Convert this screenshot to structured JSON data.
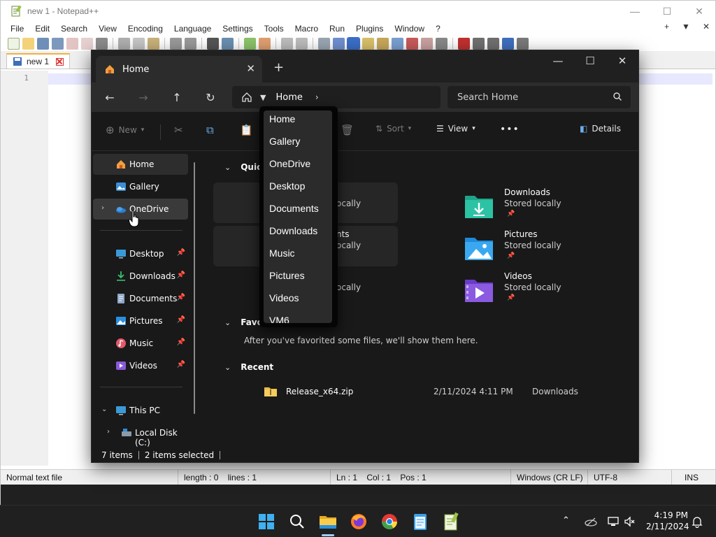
{
  "notepad": {
    "title": "new 1 - Notepad++",
    "menu": [
      "File",
      "Edit",
      "Search",
      "View",
      "Encoding",
      "Language",
      "Settings",
      "Tools",
      "Macro",
      "Run",
      "Plugins",
      "Window",
      "?"
    ],
    "menu_right": [
      "+",
      "▼",
      "✕"
    ],
    "tab_label": "new 1",
    "line_number": "1",
    "status": {
      "type": "Normal text file",
      "length_lines": "length : 0    lines : 1",
      "position": "Ln : 1    Col : 1    Pos : 1",
      "eol": "Windows (CR LF)",
      "encoding": "UTF-8",
      "mode": "INS"
    }
  },
  "explorer": {
    "tab_title": "Home",
    "address": {
      "current": "Home"
    },
    "search_placeholder": "Search Home",
    "commands": {
      "new": "New",
      "sort": "Sort",
      "view": "View",
      "details": "Details",
      "more": "•••"
    },
    "sidebar": {
      "top": [
        {
          "label": "Home",
          "icon": "home-icon"
        },
        {
          "label": "Gallery",
          "icon": "gallery-icon"
        },
        {
          "label": "OneDrive",
          "icon": "onedrive-icon"
        }
      ],
      "pinned": [
        {
          "label": "Desktop",
          "icon": "desktop-icon"
        },
        {
          "label": "Downloads",
          "icon": "downloads-icon"
        },
        {
          "label": "Documents",
          "icon": "documents-icon"
        },
        {
          "label": "Pictures",
          "icon": "pictures-icon"
        },
        {
          "label": "Music",
          "icon": "music-icon"
        },
        {
          "label": "Videos",
          "icon": "videos-icon"
        }
      ],
      "this_pc": "This PC",
      "local_disk": "Local Disk (C:)"
    },
    "quick_access": {
      "heading_partial": "Quic",
      "partial_texts": [
        "ocally",
        "nts",
        "ocally",
        "ocally"
      ],
      "items": [
        {
          "name": "Downloads",
          "sub": "Stored locally",
          "icon": "downloads-folder-icon"
        },
        {
          "name": "Pictures",
          "sub": "Stored locally",
          "icon": "pictures-folder-icon"
        },
        {
          "name": "Videos",
          "sub": "Stored locally",
          "icon": "videos-folder-icon"
        }
      ]
    },
    "favorites": {
      "heading_partial": "Favo",
      "empty_message": "After you've favorited some files, we'll show them here."
    },
    "recent": {
      "heading": "Recent",
      "rows": [
        {
          "name": "Release_x64.zip",
          "date": "2/11/2024 4:11 PM",
          "location": "Downloads"
        }
      ]
    },
    "status": {
      "items": "7 items",
      "selected": "2 items selected"
    }
  },
  "breadcrumb_dropdown": {
    "items": [
      "Home",
      "Gallery",
      "OneDrive",
      "Desktop",
      "Documents",
      "Downloads",
      "Music",
      "Pictures",
      "Videos",
      "VM6"
    ]
  },
  "taskbar": {
    "time": "4:19 PM",
    "date": "2/11/2024",
    "apps": [
      "windows-start-icon",
      "search-icon",
      "file-explorer-icon",
      "firefox-icon",
      "chrome-icon",
      "notepad-icon",
      "notepadpp-icon"
    ]
  }
}
